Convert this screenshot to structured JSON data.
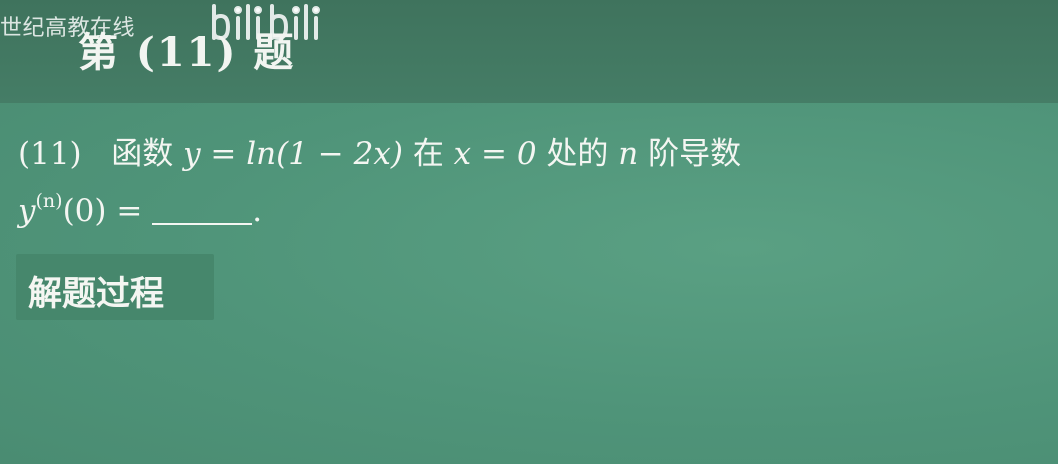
{
  "watermark": {
    "text": "世纪高教在线",
    "logo": "bilibili"
  },
  "heading": {
    "text": "第 (11) 题"
  },
  "problem": {
    "number": "(11)",
    "text1": "函数",
    "function_expr": "y = ln(1 − 2x)",
    "text2": "在",
    "point_expr": "x = 0",
    "text3": "处的",
    "var_n": "n",
    "text4": "阶导数",
    "derivative_base": "y",
    "derivative_sup": "(n)",
    "derivative_arg": "(0) =",
    "period": "."
  },
  "solution": {
    "label": "解题过程"
  },
  "icons": {
    "logo": "bilibili-logo-icon"
  },
  "colors": {
    "board": "#4f9479",
    "header": "#3f735d",
    "text": "#f4f6f2"
  }
}
